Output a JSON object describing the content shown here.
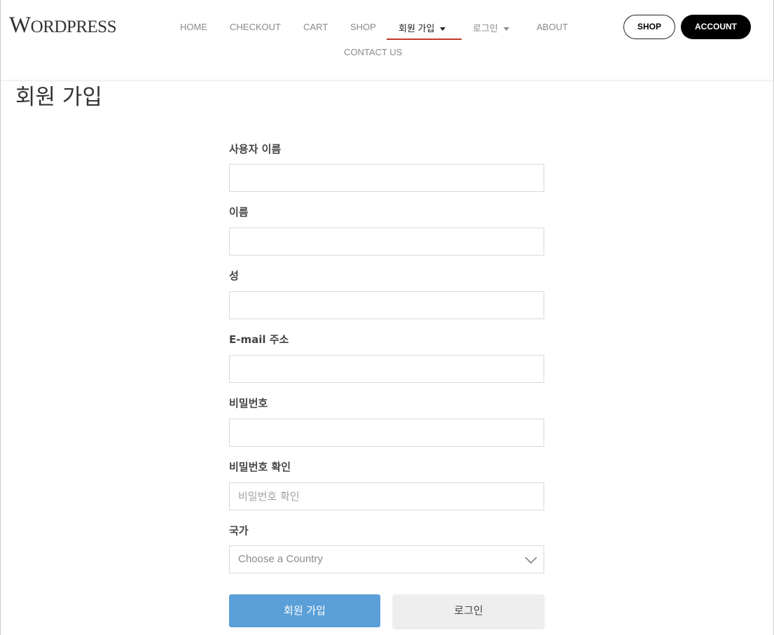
{
  "header": {
    "logo": {
      "main": "W",
      "rest": "ORDPRESS",
      "full": "WordPress"
    },
    "nav": [
      {
        "label": "HOME"
      },
      {
        "label": "CHECKOUT"
      },
      {
        "label": "CART"
      },
      {
        "label": "SHOP"
      },
      {
        "label": "회원 가입",
        "dropdown": true,
        "active": true
      },
      {
        "label": "로그인",
        "dropdown": true
      },
      {
        "label": "ABOUT"
      },
      {
        "label": "CONTACT US"
      }
    ],
    "shop_button": "SHOP",
    "account_button": "ACCOUNT"
  },
  "page": {
    "title": "회원 가입"
  },
  "form": {
    "username": {
      "label": "사용자 이름",
      "value": "",
      "placeholder": ""
    },
    "first_name": {
      "label": "이름",
      "value": "",
      "placeholder": ""
    },
    "last_name": {
      "label": "성",
      "value": "",
      "placeholder": ""
    },
    "email": {
      "label": "E-mail 주소",
      "value": "",
      "placeholder": ""
    },
    "password": {
      "label": "비밀번호",
      "value": "",
      "placeholder": ""
    },
    "password_confirm": {
      "label": "비밀번호 확인",
      "value": "",
      "placeholder": "비밀번호 확인"
    },
    "country": {
      "label": "국가",
      "selected": "Choose a Country"
    },
    "submit_label": "회원 가입",
    "login_label": "로그인"
  },
  "colors": {
    "accent_underline": "#c0392b",
    "primary_button": "#5b9fd8",
    "account_button_bg": "#000000"
  },
  "icons": {
    "nav_dropdown": "caret-down-icon",
    "select": "chevron-down-icon"
  }
}
